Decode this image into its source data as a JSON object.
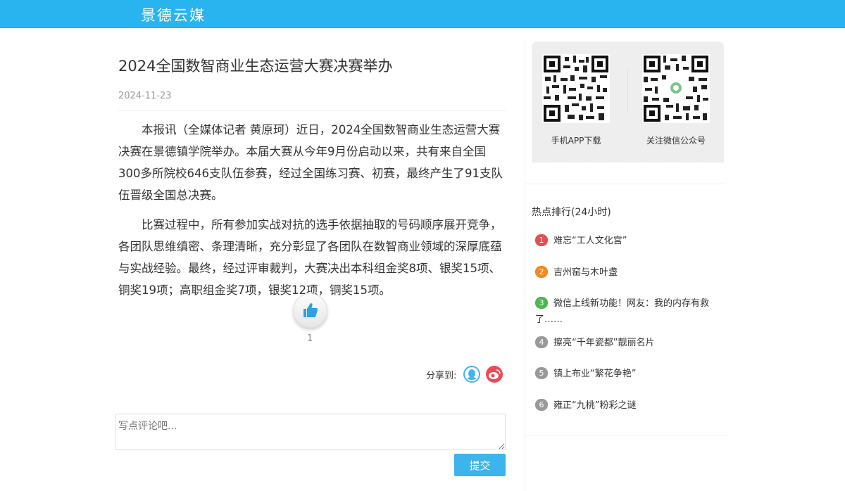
{
  "header": {
    "brand": "景德云媒"
  },
  "article": {
    "title": "2024全国数智商业生态运营大赛决赛举办",
    "date": "2024-11-23",
    "paragraphs": [
      "本报讯（全媒体记者 黄原珂）近日，2024全国数智商业生态运营大赛决赛在景德镇学院举办。本届大赛从今年9月份启动以来，共有来自全国300多所院校646支队伍参赛，经过全国练习赛、初赛，最终产生了91支队伍晋级全国总决赛。",
      "比赛过程中，所有参加实战对抗的选手依据抽取的号码顺序展开竞争，各团队思维缜密、条理清晰，充分彰显了各团队在数智商业领域的深厚底蕴与实战经验。最终，经过评审裁判，大赛决出本科组金奖8项、银奖15项、铜奖19项；高职组金奖7项，银奖12项，铜奖15项。"
    ],
    "like_count": "1",
    "share_label": "分享到:"
  },
  "comment": {
    "placeholder": "写点评论吧...",
    "submit_label": "提交"
  },
  "sidebar": {
    "qr": [
      {
        "label": "手机APP下载"
      },
      {
        "label": "关注微信公众号"
      }
    ],
    "hot_title": "热点排行(24小时)",
    "hot_items": [
      {
        "rank": "1",
        "text": "难忘“工人文化宫”",
        "color": "#e05050"
      },
      {
        "rank": "2",
        "text": "吉州窑与木叶盏",
        "color": "#f08a24"
      },
      {
        "rank": "3",
        "text": "微信上线新功能！网友：我的内存有救了……",
        "color": "#4cb84c"
      },
      {
        "rank": "4",
        "text": "擦亮“千年瓷都”靓丽名片",
        "color": "#999999"
      },
      {
        "rank": "5",
        "text": "镇上布业“繁花争艳”",
        "color": "#999999"
      },
      {
        "rank": "6",
        "text": "雍正“九桃”粉彩之谜",
        "color": "#999999"
      }
    ]
  }
}
